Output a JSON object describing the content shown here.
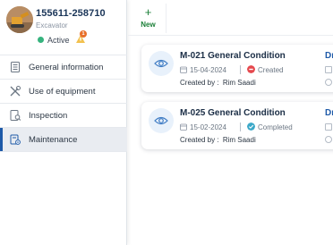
{
  "profile": {
    "asset_id": "155611-258710",
    "asset_type": "Excavator",
    "status": "Active",
    "notification_count": "1"
  },
  "sidebar": {
    "items": [
      {
        "label": "General information",
        "icon": "document-list-icon"
      },
      {
        "label": "Use of equipment",
        "icon": "tools-icon"
      },
      {
        "label": "Inspection",
        "icon": "inspection-icon"
      },
      {
        "label": "Maintenance",
        "icon": "maintenance-icon",
        "active": true
      }
    ]
  },
  "toolbar": {
    "new_plus": "+",
    "new_label": "New"
  },
  "cards": [
    {
      "title": "M-021 General Condition",
      "date": "15-04-2024",
      "status": "Created",
      "status_color": "#e5484d",
      "created_by_label": "Created by :",
      "created_by": "Rim Saadi",
      "right_label": "Dr"
    },
    {
      "title": "M-025 General Condition",
      "date": "15-02-2024",
      "status": "Completed",
      "status_color": "#3ba8c8",
      "created_by_label": "Created by :",
      "created_by": "Rim Saadi",
      "right_label": "Dr"
    }
  ],
  "colors": {
    "accent": "#1e5aa8",
    "active_status": "#36b37e",
    "new_button": "#1a7f37"
  }
}
